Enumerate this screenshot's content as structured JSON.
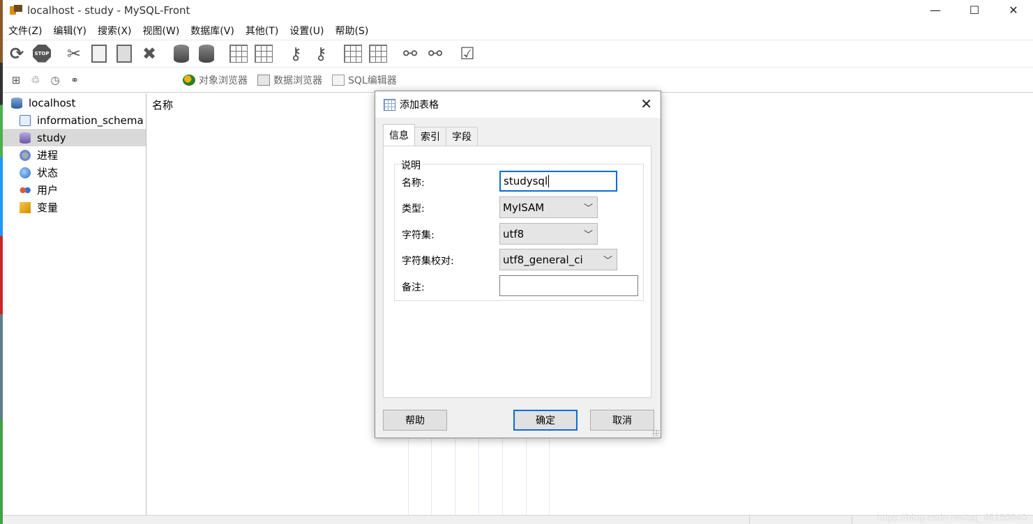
{
  "window": {
    "title": "localhost - study - MySQL-Front",
    "minimize": "—",
    "maximize": "☐",
    "close": "✕"
  },
  "menu": [
    "文件(Z)",
    "编辑(Y)",
    "搜索(X)",
    "视图(W)",
    "数据库(V)",
    "其他(T)",
    "设置(U)",
    "帮助(S)"
  ],
  "toolbar_icons": [
    "refresh-icon",
    "stop-icon",
    "cut-icon",
    "copy-icon",
    "paste-icon",
    "delete-icon",
    "add-database-icon",
    "drop-database-icon",
    "add-table-icon",
    "drop-table-icon",
    "add-field-icon",
    "drop-field-icon",
    "add-index-icon",
    "drop-index-icon",
    "add-link-icon",
    "drop-link-icon",
    "checklist-icon"
  ],
  "views": {
    "object_browser": "对象浏览器",
    "data_browser": "数据浏览器",
    "sql_editor": "SQL编辑器"
  },
  "tree": {
    "root": "localhost",
    "items": [
      {
        "label": "information_schema",
        "icon": "schema-icon"
      },
      {
        "label": "study",
        "icon": "database-icon",
        "selected": true
      },
      {
        "label": "进程",
        "icon": "processes-icon"
      },
      {
        "label": "状态",
        "icon": "status-icon"
      },
      {
        "label": "用户",
        "icon": "users-icon"
      },
      {
        "label": "变量",
        "icon": "variables-icon"
      }
    ]
  },
  "content": {
    "column_header": "名称"
  },
  "dialog": {
    "title": "添加表格",
    "tabs": [
      "信息",
      "索引",
      "字段"
    ],
    "active_tab": "信息",
    "group_label": "说明",
    "fields": {
      "name_label": "名称:",
      "name_value": "studysql",
      "type_label": "类型:",
      "type_value": "MyISAM",
      "charset_label": "字符集:",
      "charset_value": "utf8",
      "collation_label": "字符集校对:",
      "collation_value": "utf8_general_ci",
      "comment_label": "备注:",
      "comment_value": ""
    },
    "buttons": {
      "help": "帮助",
      "ok": "确定",
      "cancel": "取消"
    }
  },
  "watermark": "https://blog.csdn.net/qq_46150940"
}
